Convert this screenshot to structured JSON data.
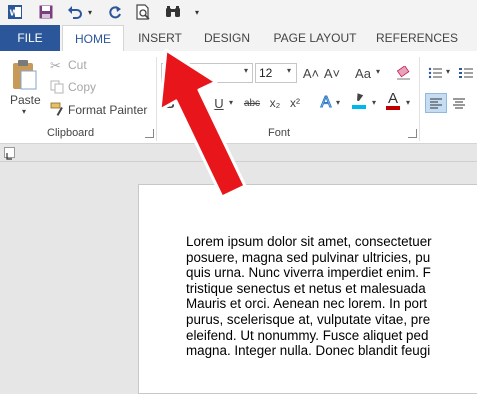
{
  "qat": {
    "app_icon": "word-icon",
    "save_icon": "save-icon",
    "undo_icon": "undo-icon",
    "redo_icon": "redo-icon",
    "print_preview_icon": "print-preview-icon",
    "find_icon": "binoculars-icon",
    "customize_icon": "customize-dropdown-icon"
  },
  "tabs": [
    "FILE",
    "HOME",
    "INSERT",
    "DESIGN",
    "PAGE LAYOUT",
    "REFERENCES"
  ],
  "clipboard": {
    "paste": "Paste",
    "cut": "Cut",
    "copy": "Copy",
    "format_painter": "Format Painter",
    "group_label": "Clipboard"
  },
  "font": {
    "font_name": "",
    "font_size": "12",
    "grow": "A˄",
    "shrink": "A˅",
    "change_case": "Aa",
    "bold": "B",
    "italic": "I",
    "underline": "U",
    "strikethrough": "abc",
    "subscript": "x₂",
    "superscript": "x²",
    "text_effects": "A",
    "font_color": "A",
    "group_label": "Font"
  },
  "colors": {
    "file_tab": "#2b579a",
    "highlight": "#ffff00",
    "font_color": "#c00000",
    "arrow": "#e8151b"
  },
  "document": {
    "lines": [
      "Lorem ipsum dolor sit amet, consectetuer",
      "posuere, magna sed pulvinar ultricies, pu",
      "quis urna. Nunc viverra imperdiet enim. F",
      "tristique senectus et netus et malesuada",
      "Mauris et orci. Aenean nec lorem. In port",
      "purus, scelerisque at, vulputate vitae, pre",
      "eleifend. Ut nonummy. Fusce aliquet ped",
      "magna. Integer nulla. Donec blandit feugi"
    ]
  }
}
